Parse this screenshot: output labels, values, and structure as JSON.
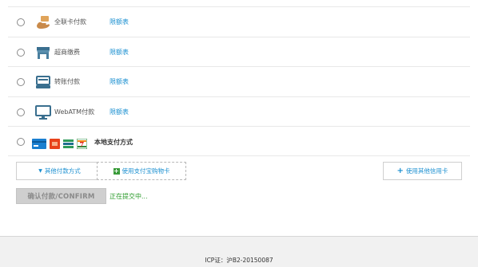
{
  "payment_methods": [
    {
      "label": "全联卡付款",
      "limit_label": "限额表",
      "icon": "hand-card-icon"
    },
    {
      "label": "超商缴费",
      "limit_label": "限额表",
      "icon": "store-icon"
    },
    {
      "label": "转账付款",
      "limit_label": "限额表",
      "icon": "transfer-icon"
    },
    {
      "label": "WebATM付款",
      "limit_label": "限额表",
      "icon": "monitor-icon"
    }
  ],
  "local_payment": {
    "label": "本地支付方式",
    "logos": [
      "card-icon",
      "wallet-icon",
      "bank-icon",
      "seven-eleven-icon"
    ]
  },
  "buttons": {
    "other_methods": "其他付款方式",
    "gift_card": "使用支付宝购物卡",
    "other_card": "使用其他信用卡",
    "confirm": "确认付款/CONFIRM"
  },
  "status_text": "正在提交中...",
  "footer": {
    "icp": "ICP证：沪B2-20150087"
  },
  "colors": {
    "link": "#1a8fd0",
    "status": "#2a9b2a",
    "confirm_bg": "#cfcfcf"
  }
}
